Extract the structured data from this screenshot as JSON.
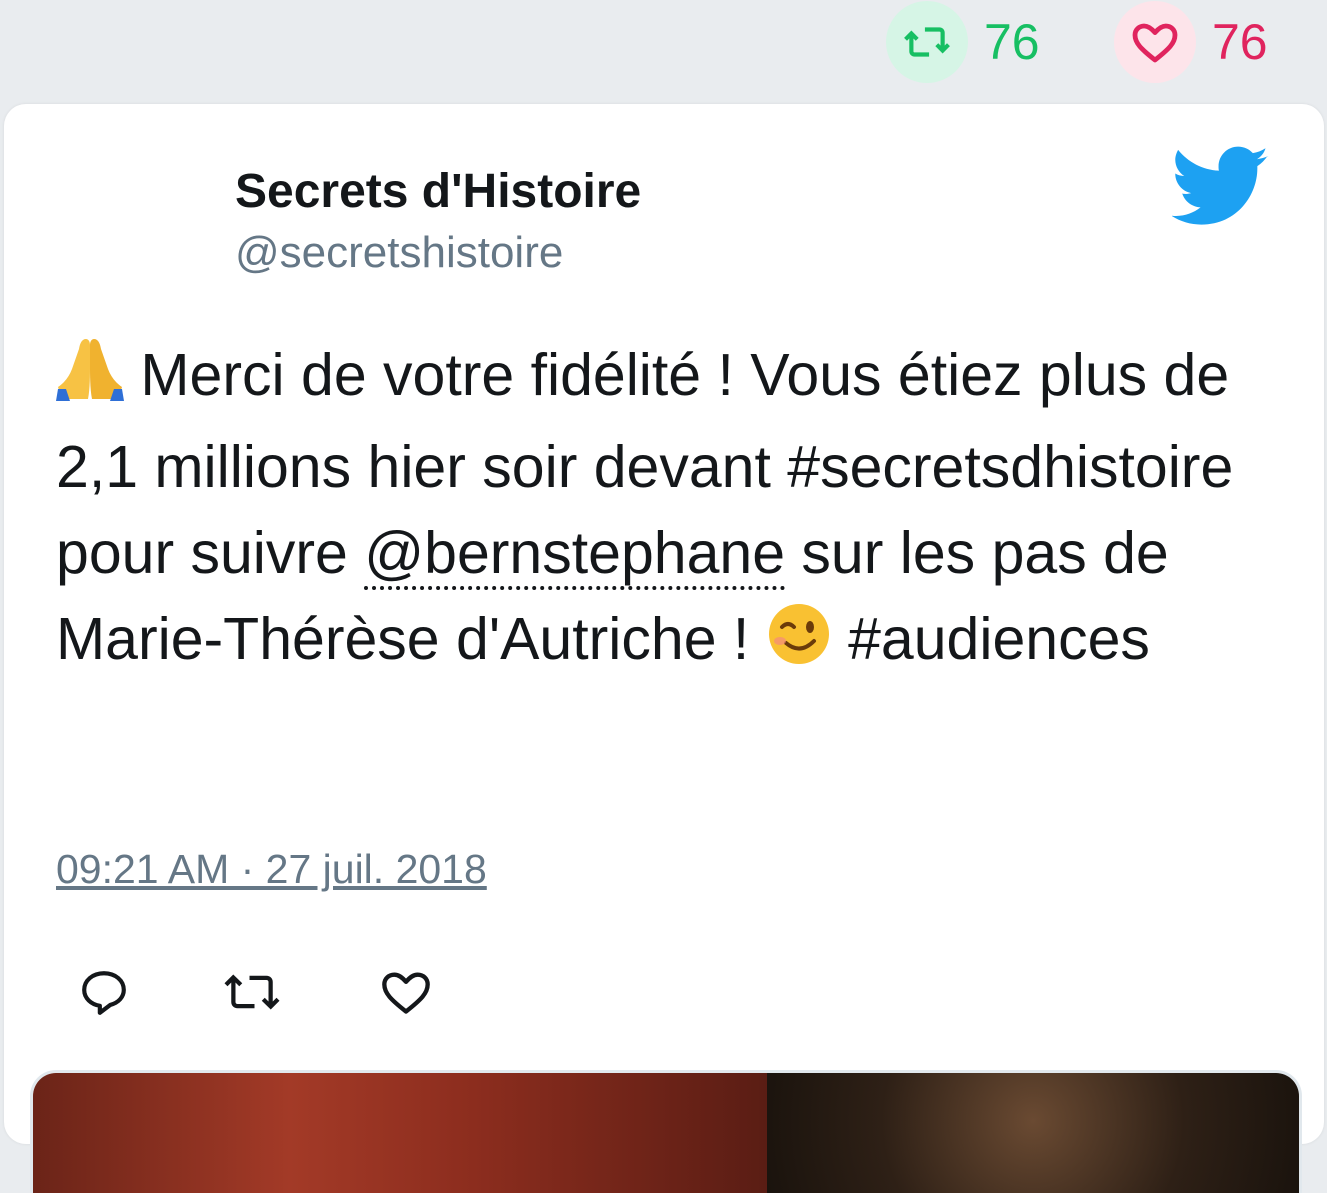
{
  "stats": {
    "retweet_count": "76",
    "like_count": "76"
  },
  "tweet": {
    "author_name": "Secrets d'Histoire",
    "author_handle": "@secretshistoire",
    "text_part1": " Merci de votre fidélité ! Vous étiez plus de 2,1 millions hier soir devant #secretsdhistoire pour suivre ",
    "mention": "@bernstephane",
    "text_part2": " sur les pas de Marie-Thérèse d'Autriche ! ",
    "text_part3": " #audiences",
    "emoji_pray": "🙏",
    "emoji_wink": "😉",
    "timestamp": "09:21 AM · 27 juil. 2018"
  },
  "icons": {
    "brand": "twitter-bird-icon",
    "actions": [
      "reply-icon",
      "retweet-icon",
      "like-icon"
    ]
  },
  "colors": {
    "retweet": "#17bf63",
    "like": "#e0245e",
    "twitter_blue": "#1da1f2"
  }
}
